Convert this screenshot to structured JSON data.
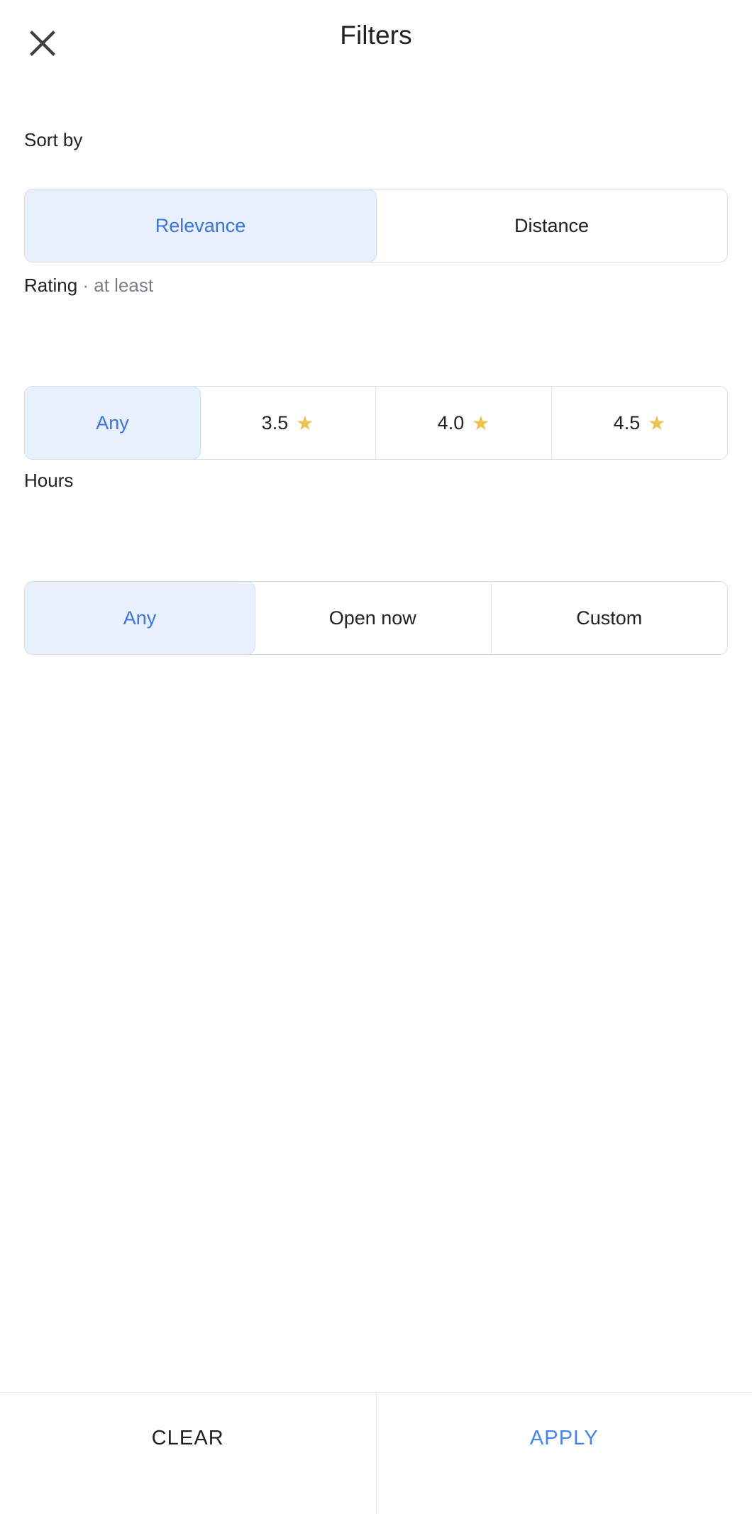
{
  "header": {
    "title": "Filters",
    "close_icon": "close-icon"
  },
  "sections": [
    {
      "key": "sort_by",
      "label": "Sort by",
      "label_muted": "",
      "options": [
        {
          "label": "Relevance",
          "selected": true,
          "star": false
        },
        {
          "label": "Distance",
          "selected": false,
          "star": false
        }
      ]
    },
    {
      "key": "rating",
      "label": "Rating",
      "label_muted": " · at least",
      "options": [
        {
          "label": "Any",
          "selected": true,
          "star": false
        },
        {
          "label": "3.5",
          "selected": false,
          "star": true
        },
        {
          "label": "4.0",
          "selected": false,
          "star": true
        },
        {
          "label": "4.5",
          "selected": false,
          "star": true
        }
      ]
    },
    {
      "key": "hours",
      "label": "Hours",
      "label_muted": "",
      "options": [
        {
          "label": "Any",
          "selected": true,
          "star": false
        },
        {
          "label": "Open now",
          "selected": false,
          "star": false
        },
        {
          "label": "Custom",
          "selected": false,
          "star": false
        }
      ]
    }
  ],
  "footer": {
    "clear_label": "CLEAR",
    "apply_label": "APPLY"
  },
  "icons": {
    "star_glyph": "★"
  },
  "colors": {
    "accent_blue": "#4285f4",
    "selected_bg": "#e8f0fe",
    "selected_text": "#3b74e0",
    "star_gold": "#f2c14a",
    "text_primary": "#202124",
    "text_muted": "#7a7f85",
    "border": "#dadce0"
  }
}
